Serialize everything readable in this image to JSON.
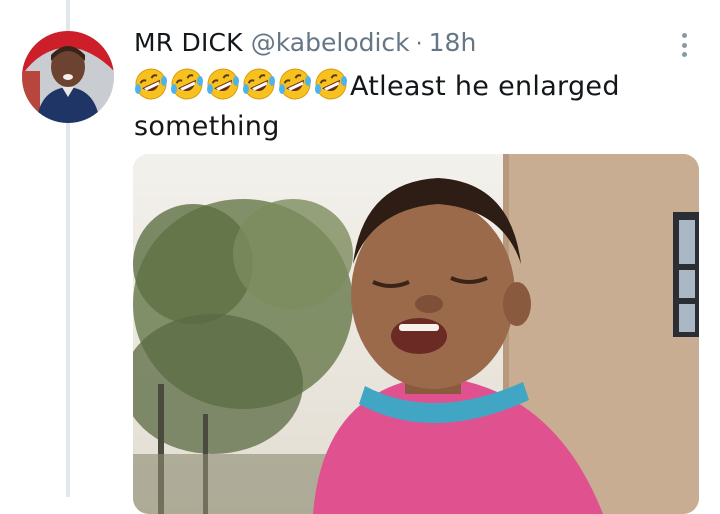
{
  "tweet": {
    "display_name": "MR DICK",
    "handle": "@kabelodick",
    "separator": "·",
    "time": "18h",
    "emoji_count": 6,
    "emoji_name": "rolling-on-the-floor-laughing-emoji",
    "text_line1": "Atleast he enlarged",
    "text_line2": "something",
    "more_icon": "more-vertical-icon"
  },
  "colors": {
    "name": "#14171a",
    "muted": "#657786",
    "thread_line": "#e1e8ed",
    "avatar_ring": "#d9262c"
  }
}
